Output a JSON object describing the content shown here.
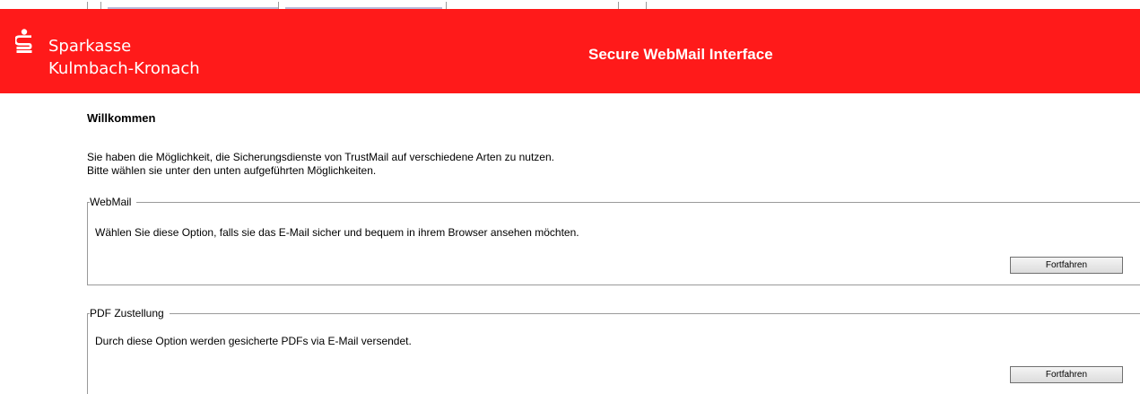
{
  "brand": {
    "line1": "Sparkasse",
    "line2": "Kulmbach-Kronach",
    "logo_icon": "sparkasse-s-logo-icon"
  },
  "header": {
    "title": "Secure WebMail Interface",
    "bg_color": "#ff1a1a"
  },
  "welcome": {
    "heading": "Willkommen"
  },
  "intro": {
    "line1": "Sie haben die Möglichkeit, die Sicherungsdienste von TrustMail auf verschiedene Arten zu nutzen.",
    "line2": "Bitte wählen sie unter den unten aufgeführten Möglichkeiten."
  },
  "options": [
    {
      "legend": "WebMail",
      "description": "Wählen Sie diese Option, falls sie das E-Mail sicher und bequem in ihrem Browser ansehen möchten.",
      "button_label": "Fortfahren"
    },
    {
      "legend": "PDF Zustellung",
      "description": "Durch diese Option werden gesicherte PDFs via E-Mail versendet.",
      "button_label": "Fortfahren"
    }
  ]
}
